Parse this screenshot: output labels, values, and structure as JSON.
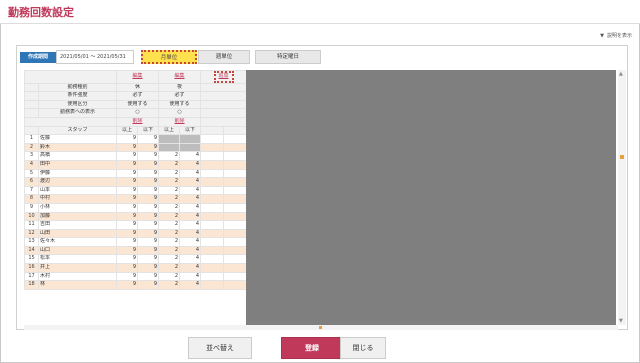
{
  "page": {
    "title": "勤務回数設定"
  },
  "help": {
    "icon": "triangle-down-icon",
    "label": "説明を表示"
  },
  "period": {
    "label": "作成期間",
    "value": "2021/05/01 〜 2021/05/31"
  },
  "modes": [
    {
      "label": "月単位",
      "active": true
    },
    {
      "label": "週単位",
      "active": false
    },
    {
      "label": "特定曜日",
      "active": false
    }
  ],
  "table": {
    "edit_label": "編集",
    "new_label": "追加",
    "delete_label": "削除",
    "row_labels": {
      "kind": "勤務種別",
      "strength": "条件強度",
      "usage": "使用区分",
      "display": "勤務表への表示",
      "staff": "スタッフ"
    },
    "columns": [
      {
        "kind": "休",
        "strength": "必ず",
        "usage": "使用する",
        "display": "○"
      },
      {
        "kind": "夜",
        "strength": "必ず",
        "usage": "使用する",
        "display": "○"
      }
    ],
    "sub_headers": [
      "以上",
      "以下",
      "以上",
      "以下"
    ],
    "rows": [
      {
        "no": "1",
        "name": "佐藤",
        "v": [
          "9",
          "9",
          "",
          ""
        ]
      },
      {
        "no": "2",
        "name": "鈴木",
        "v": [
          "9",
          "9",
          "",
          ""
        ]
      },
      {
        "no": "3",
        "name": "高橋",
        "v": [
          "9",
          "9",
          "2",
          "4"
        ]
      },
      {
        "no": "4",
        "name": "田中",
        "v": [
          "9",
          "9",
          "2",
          "4"
        ]
      },
      {
        "no": "5",
        "name": "伊藤",
        "v": [
          "9",
          "9",
          "2",
          "4"
        ]
      },
      {
        "no": "6",
        "name": "渡辺",
        "v": [
          "9",
          "9",
          "2",
          "4"
        ]
      },
      {
        "no": "7",
        "name": "山本",
        "v": [
          "9",
          "9",
          "2",
          "4"
        ]
      },
      {
        "no": "8",
        "name": "中村",
        "v": [
          "9",
          "9",
          "2",
          "4"
        ]
      },
      {
        "no": "9",
        "name": "小林",
        "v": [
          "9",
          "9",
          "2",
          "4"
        ]
      },
      {
        "no": "10",
        "name": "加藤",
        "v": [
          "9",
          "9",
          "2",
          "4"
        ]
      },
      {
        "no": "11",
        "name": "吉田",
        "v": [
          "9",
          "9",
          "2",
          "4"
        ]
      },
      {
        "no": "12",
        "name": "山田",
        "v": [
          "9",
          "9",
          "2",
          "4"
        ]
      },
      {
        "no": "13",
        "name": "佐々木",
        "v": [
          "9",
          "9",
          "2",
          "4"
        ]
      },
      {
        "no": "14",
        "name": "山口",
        "v": [
          "9",
          "9",
          "2",
          "4"
        ]
      },
      {
        "no": "15",
        "name": "松本",
        "v": [
          "9",
          "9",
          "2",
          "4"
        ]
      },
      {
        "no": "16",
        "name": "井上",
        "v": [
          "9",
          "9",
          "2",
          "4"
        ]
      },
      {
        "no": "17",
        "name": "木村",
        "v": [
          "9",
          "9",
          "2",
          "4"
        ]
      },
      {
        "no": "18",
        "name": "林",
        "v": [
          "9",
          "9",
          "2",
          "4"
        ]
      }
    ]
  },
  "buttons": {
    "sort": "並べ替え",
    "register": "登録",
    "close": "閉じる"
  },
  "colors": {
    "accent": "#c0395a",
    "period_label": "#2e76b6",
    "active_mode": "#ffe14d",
    "row_alt": "#fbe6d4",
    "disabled_cell": "#bdbdbd",
    "canvas": "#7f7f7f"
  }
}
